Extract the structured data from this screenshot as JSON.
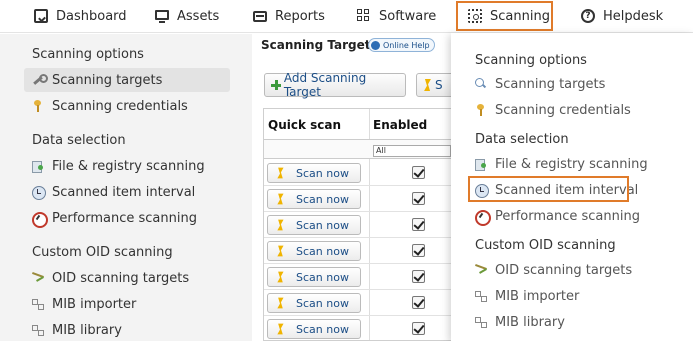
{
  "topnav": {
    "items": [
      {
        "label": "Dashboard",
        "icon": "dashboard-icon"
      },
      {
        "label": "Assets",
        "icon": "monitor-icon"
      },
      {
        "label": "Reports",
        "icon": "reports-icon"
      },
      {
        "label": "Software",
        "icon": "grid-icon"
      },
      {
        "label": "Scanning",
        "icon": "scan-icon"
      },
      {
        "label": "Helpdesk",
        "icon": "help-icon"
      }
    ],
    "active": "Scanning",
    "highlight_color": "#e07b2a"
  },
  "sidebar": {
    "groups": [
      {
        "heading": "Scanning options",
        "items": [
          {
            "label": "Scanning targets",
            "icon": "wrench-icon",
            "active": true
          },
          {
            "label": "Scanning credentials",
            "icon": "key-icon"
          }
        ]
      },
      {
        "heading": "Data selection",
        "items": [
          {
            "label": "File & registry scanning",
            "icon": "file-registry-icon"
          },
          {
            "label": "Scanned item interval",
            "icon": "clock-icon"
          },
          {
            "label": "Performance scanning",
            "icon": "gauge-icon"
          }
        ]
      },
      {
        "heading": "Custom OID scanning",
        "items": [
          {
            "label": "OID scanning targets",
            "icon": "oid-icon"
          },
          {
            "label": "MIB importer",
            "icon": "mib-importer-icon"
          },
          {
            "label": "MIB library",
            "icon": "mib-library-icon"
          }
        ]
      }
    ]
  },
  "main": {
    "title": "Scanning Targets",
    "online_help": "Online Help",
    "add_button": "Add Scanning Target",
    "second_button_partial": "S",
    "table": {
      "headers": [
        "Quick scan",
        "Enabled"
      ],
      "filter_value": "All",
      "rows": [
        {
          "scan_label": "Scan now",
          "enabled": true
        },
        {
          "scan_label": "Scan now",
          "enabled": true
        },
        {
          "scan_label": "Scan now",
          "enabled": true
        },
        {
          "scan_label": "Scan now",
          "enabled": true
        },
        {
          "scan_label": "Scan now",
          "enabled": true
        },
        {
          "scan_label": "Scan now",
          "enabled": true
        },
        {
          "scan_label": "Scan now",
          "enabled": true
        }
      ]
    }
  },
  "dropdown": {
    "groups": [
      {
        "heading": "Scanning options",
        "items": [
          {
            "label": "Scanning targets",
            "icon": "search-icon"
          },
          {
            "label": "Scanning credentials",
            "icon": "key-icon"
          }
        ]
      },
      {
        "heading": "Data selection",
        "items": [
          {
            "label": "File & registry scanning",
            "icon": "file-registry-icon"
          },
          {
            "label": "Scanned item interval",
            "icon": "clock-icon",
            "highlighted": true
          },
          {
            "label": "Performance scanning",
            "icon": "gauge-icon"
          }
        ]
      },
      {
        "heading": "Custom OID scanning",
        "items": [
          {
            "label": "OID scanning targets",
            "icon": "oid-icon"
          },
          {
            "label": "MIB importer",
            "icon": "mib-importer-icon"
          },
          {
            "label": "MIB library",
            "icon": "mib-library-icon"
          }
        ]
      }
    ]
  }
}
